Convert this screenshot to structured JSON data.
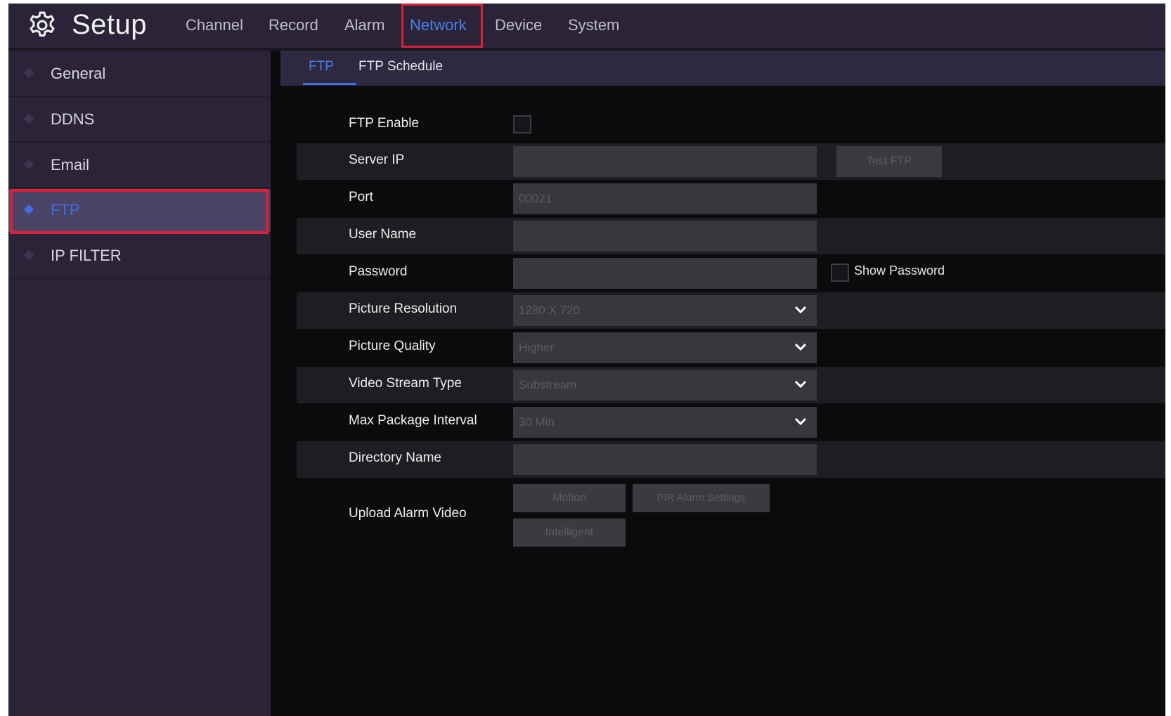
{
  "app": {
    "title": "Setup"
  },
  "nav": {
    "tabs": [
      {
        "label": "Channel"
      },
      {
        "label": "Record"
      },
      {
        "label": "Alarm"
      },
      {
        "label": "Network"
      },
      {
        "label": "Device"
      },
      {
        "label": "System"
      }
    ],
    "active": "Network"
  },
  "sidebar": {
    "items": [
      {
        "label": "General"
      },
      {
        "label": "DDNS"
      },
      {
        "label": "Email"
      },
      {
        "label": "FTP"
      },
      {
        "label": "IP FILTER"
      }
    ],
    "active": "FTP"
  },
  "subtabs": [
    {
      "label": "FTP"
    },
    {
      "label": "FTP Schedule"
    }
  ],
  "form": {
    "ftp_enable": {
      "label": "FTP Enable",
      "checked": false
    },
    "server_ip": {
      "label": "Server IP",
      "value": ""
    },
    "test_ftp_button": "Test FTP",
    "port": {
      "label": "Port",
      "value": "00021"
    },
    "user_name": {
      "label": "User Name",
      "value": ""
    },
    "password": {
      "label": "Password",
      "value": ""
    },
    "show_password": {
      "label": "Show Password",
      "checked": false
    },
    "picture_resolution": {
      "label": "Picture Resolution",
      "value": "1280 X 720"
    },
    "picture_quality": {
      "label": "Picture Quality",
      "value": "Higher"
    },
    "video_stream_type": {
      "label": "Video Stream Type",
      "value": "Substream"
    },
    "max_package_interval": {
      "label": "Max Package Interval",
      "value": "30 Min"
    },
    "directory_name": {
      "label": "Directory Name",
      "value": ""
    },
    "upload_alarm_video": {
      "label": "Upload Alarm Video",
      "buttons": [
        "Motion",
        "PIR Alarm Settings",
        "Intelligent"
      ]
    }
  },
  "colors": {
    "accent_blue": "#3d6fe0",
    "highlight_red": "#d9223a",
    "bar_bg": "#2b2438"
  },
  "icons": {
    "logo": "gear-icon",
    "dropdown": "chevron-down-icon",
    "sidebar_bullet": "diamond-icon"
  }
}
